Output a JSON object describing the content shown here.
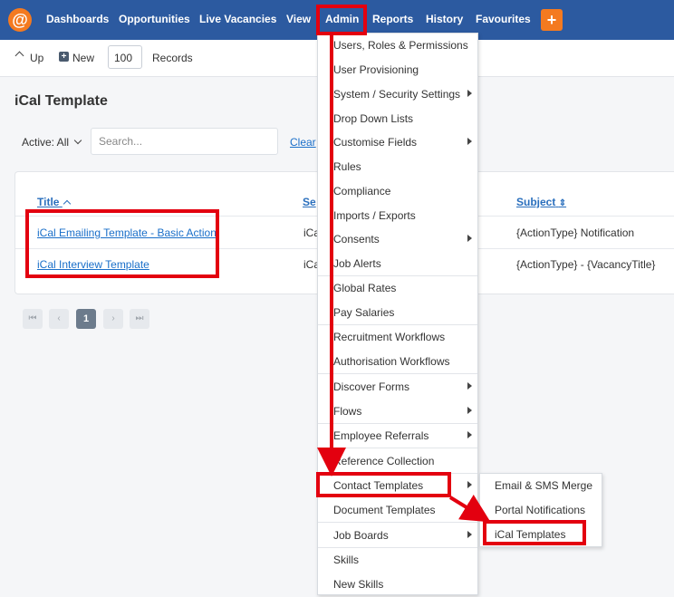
{
  "nav": {
    "logo_glyph": "@",
    "items": [
      "Dashboards",
      "Opportunities",
      "Live Vacancies",
      "View",
      "Admin",
      "Reports",
      "History",
      "Favourites"
    ],
    "plus_glyph": "+"
  },
  "toolbar": {
    "up_label": "Up",
    "new_label": "New",
    "records_value": "100",
    "records_label": "Records"
  },
  "page": {
    "title": "iCal Template"
  },
  "filter": {
    "active_label": "Active: All",
    "search_placeholder": "Search...",
    "clear_label": "Clear"
  },
  "table": {
    "columns": [
      "Title",
      "Se",
      "Subject"
    ],
    "rows": [
      {
        "title": "iCal Emailing Template - Basic Action",
        "sender": "iCa",
        "subject": "{ActionType} Notification"
      },
      {
        "title": "iCal Interview Template",
        "sender": "iCa",
        "subject": "{ActionType} - {VacancyTitle}"
      }
    ]
  },
  "pagination": {
    "first": "⏮",
    "prev": "‹",
    "current": "1",
    "next": "›",
    "last": "⏭"
  },
  "admin_menu": {
    "items": [
      "Users, Roles & Permissions",
      "User Provisioning",
      "System / Security Settings",
      "Drop Down Lists",
      "Customise Fields",
      "Rules",
      "Compliance",
      "Imports / Exports",
      "Consents",
      "Job Alerts",
      "Global Rates",
      "Pay Salaries",
      "Recruitment Workflows",
      "Authorisation Workflows",
      "Discover Forms",
      "Flows",
      "Employee Referrals",
      "Reference Collection",
      "Contact Templates",
      "Document Templates",
      "Job Boards",
      "Skills",
      "New Skills"
    ]
  },
  "contact_submenu": {
    "items": [
      "Email & SMS Merge",
      "Portal Notifications",
      "iCal Templates"
    ]
  },
  "colors": {
    "nav_bg": "#2c5aa0",
    "accent": "#f47a20",
    "highlight": "#e3000f",
    "link": "#1a6fc9"
  }
}
